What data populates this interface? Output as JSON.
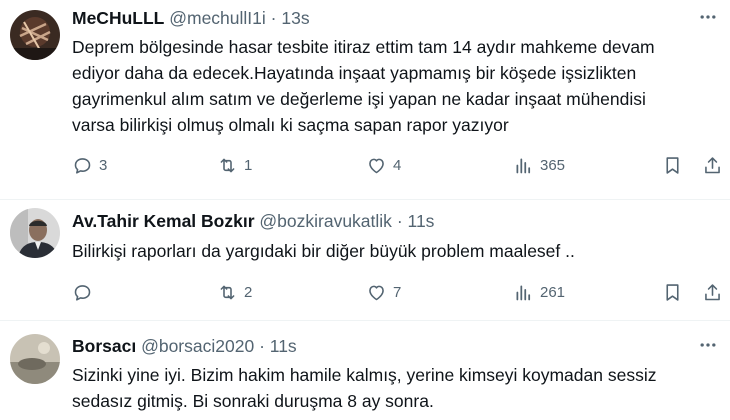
{
  "tweets": [
    {
      "name": "MeCHuLLL",
      "handle": "@mechullI1i",
      "separator": "·",
      "time": "13s",
      "lines": [
        "Deprem bölgesinde hasar tesbite itiraz ettim tam 14 aydır mahkeme devam",
        "ediyor daha da edecek.Hayatında inşaat yapmamış bir köşede işsizlikten",
        "gayrimenkul alım satım ve değerleme işi yapan ne kadar inşaat mühendisi",
        "varsa bilirkişi olmuş olmalı ki saçma sapan rapor yazıyor"
      ],
      "replies": "3",
      "retweets": "1",
      "likes": "4",
      "views": "365"
    },
    {
      "name": "Av.Tahir Kemal Bozkır",
      "handle": "@bozkiravukatlik",
      "separator": "·",
      "time": "11s",
      "lines": [
        "Bilirkişi raporları da yargıdaki bir diğer büyük problem maalesef .."
      ],
      "replies": "",
      "retweets": "2",
      "likes": "7",
      "views": "261"
    },
    {
      "name": "Borsacı",
      "handle": "@borsaci2020",
      "separator": "·",
      "time": "11s",
      "lines": [
        "Sizinki yine iyi. Bizim hakim hamile kalmış, yerine kimseyi koymadan sessiz",
        "sedasız gitmiş. Bi sonraki duruşma 8 ay sonra."
      ]
    }
  ],
  "icons": {
    "reply": "reply-icon",
    "retweet": "retweet-icon",
    "like": "heart-icon",
    "views": "views-icon",
    "bookmark": "bookmark-icon",
    "share": "share-icon",
    "more": "more-icon"
  },
  "colors": {
    "text": "#0f1419",
    "secondary": "#536471",
    "divider": "#eff3f4"
  }
}
